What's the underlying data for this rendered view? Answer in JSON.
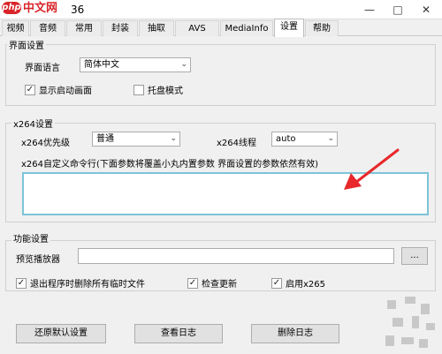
{
  "window": {
    "logo_php": "php",
    "logo_site": "中文网",
    "title": "36",
    "minimize": "—",
    "maximize": "□",
    "close": "✕"
  },
  "tabs": [
    "视频",
    "音频",
    "常用",
    "封装",
    "抽取",
    "AVS",
    "MediaInfo",
    "设置",
    "帮助"
  ],
  "ui_settings": {
    "title": "界面设置",
    "language_label": "界面语言",
    "language_value": "简体中文",
    "show_splash": "显示启动画面",
    "tray_mode": "托盘模式"
  },
  "x264": {
    "title": "x264设置",
    "priority_label": "x264优先级",
    "priority_value": "普通",
    "threads_label": "x264线程",
    "threads_value": "auto",
    "custom_cmd_label": "x264自定义命令行(下面参数将覆盖小丸内置参数 界面设置的参数依然有效)",
    "custom_cmd_value": ""
  },
  "features": {
    "title": "功能设置",
    "preview_player_label": "预览播放器",
    "preview_player_value": "",
    "browse_label": "...",
    "delete_temp": "退出程序时删除所有临时文件",
    "check_update": "检查更新",
    "enable_x265": "启用x265"
  },
  "buttons": {
    "restore": "还原默认设置",
    "view_log": "查看日志",
    "delete_log": "删除日志"
  },
  "colors": {
    "annotation_arrow": "#e8282b",
    "accent_border": "#7ec3d8"
  }
}
